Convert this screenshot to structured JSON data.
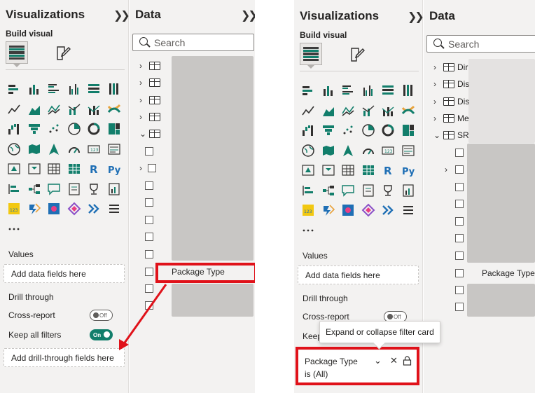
{
  "left": {
    "viz": {
      "title": "Visualizations",
      "build_visual_label": "Build visual",
      "values_label": "Values",
      "values_well": "Add data fields here",
      "drill_label": "Drill through",
      "cross_report_label": "Cross-report",
      "cross_report_state": "Off",
      "keep_filters_label": "Keep all filters",
      "keep_filters_state": "On",
      "drill_well": "Add drill-through fields here"
    },
    "data": {
      "title": "Data",
      "search_placeholder": "Search",
      "highlighted_field": "Package Type"
    }
  },
  "right": {
    "viz": {
      "title": "Visualizations",
      "build_visual_label": "Build visual",
      "values_label": "Values",
      "values_well": "Add data fields here",
      "drill_label": "Drill through",
      "cross_report_label": "Cross-report",
      "cross_report_state": "Off",
      "keep_filters_label_partial": "Keep",
      "tooltip": "Expand or collapse filter card",
      "filter_card": {
        "field": "Package Type",
        "value": "is (All)"
      }
    },
    "data": {
      "title": "Data",
      "search_placeholder": "Search",
      "tables": [
        "Dir",
        "Dis",
        "Dis",
        "Me",
        "SR"
      ],
      "field": "Package Type"
    }
  },
  "icons": {
    "collapse": "double-chevron-right-icon",
    "table": "table-icon",
    "format": "format-visual-icon"
  },
  "colors": {
    "accent": "#127e6b",
    "highlight": "#e0121a"
  }
}
